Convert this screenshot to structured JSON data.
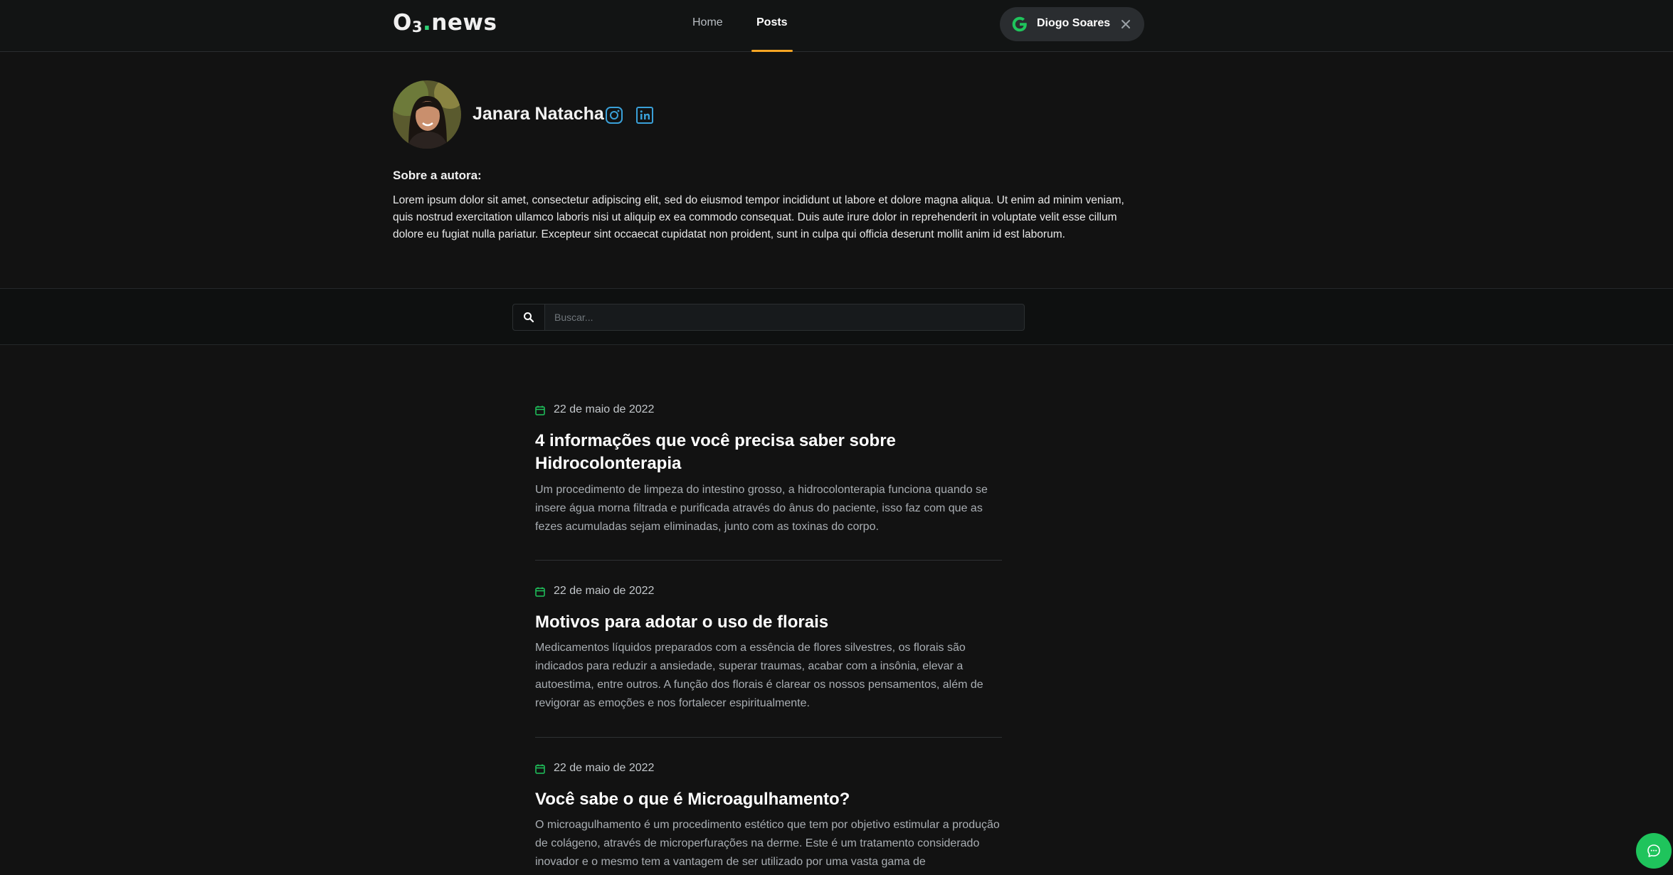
{
  "header": {
    "logo": {
      "main": "O",
      "sub": "3",
      "dot": ".",
      "rest": "news"
    },
    "nav": [
      {
        "label": "Home"
      },
      {
        "label": "Posts",
        "active": true
      }
    ],
    "user": {
      "name": "Diogo Soares",
      "provider_icon": "google-icon",
      "close_icon": "close-icon"
    }
  },
  "author": {
    "name": "Janara Natacha",
    "socials": [
      "instagram-icon",
      "linkedin-icon"
    ],
    "about_title": "Sobre a autora:",
    "about_text": "Lorem ipsum dolor sit amet, consectetur adipiscing elit, sed do eiusmod tempor incididunt ut labore et dolore magna aliqua. Ut enim ad minim veniam, quis nostrud exercitation ullamco laboris nisi ut aliquip ex ea commodo consequat. Duis aute irure dolor in reprehenderit in voluptate velit esse cillum dolore eu fugiat nulla pariatur. Excepteur sint occaecat cupidatat non proident, sunt in culpa qui officia deserunt mollit anim id est laborum."
  },
  "search": {
    "placeholder": "Buscar...",
    "value": ""
  },
  "posts": [
    {
      "date": "22 de maio de 2022",
      "title": "4 informações que você precisa saber sobre Hidrocolonterapia",
      "excerpt": "Um procedimento de limpeza do intestino grosso, a hidrocolonterapia funciona quando se insere água morna filtrada e purificada através do ânus do paciente, isso faz com que as fezes acumuladas sejam eliminadas, junto com as toxinas do corpo."
    },
    {
      "date": "22 de maio de 2022",
      "title": "Motivos para adotar o uso de florais",
      "excerpt": "Medicamentos líquidos preparados com a essência de flores silvestres, os florais são indicados para reduzir a ansiedade, superar traumas, acabar com a insônia, elevar a autoestima, entre outros. A função dos florais é clarear os nossos pensamentos, além de revigorar as emoções e nos fortalecer espiritualmente."
    },
    {
      "date": "22 de maio de 2022",
      "title": "Você sabe o que é Microagulhamento?",
      "excerpt": "O microagulhamento é um procedimento estético que tem por objetivo estimular a produção de colágeno, através de microperfurações na derme. Este é um tratamento considerado inovador e o mesmo tem a vantagem de ser utilizado por uma vasta gama de"
    }
  ],
  "colors": {
    "accent": "#f5a524",
    "brand_green": "#1fc45c",
    "social_blue": "#3aa0d8",
    "background": "#121212"
  },
  "chat_button_icon": "chat-icon"
}
